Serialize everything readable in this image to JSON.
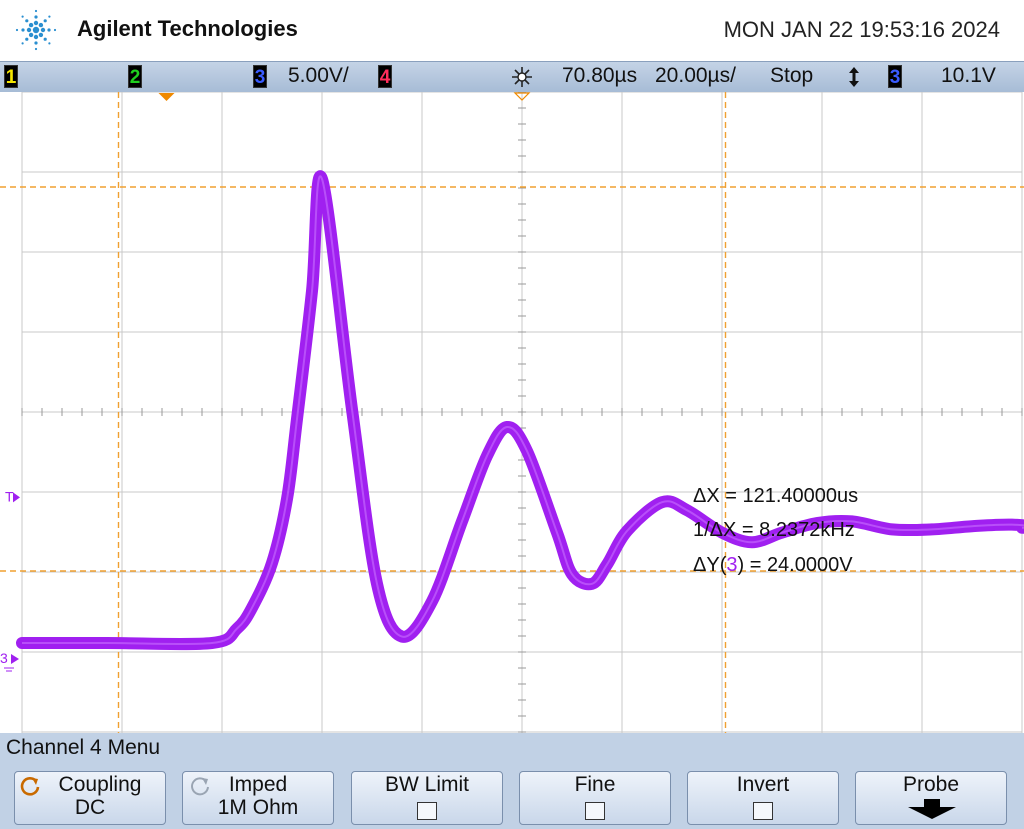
{
  "header": {
    "brand": "Agilent Technologies",
    "datetime": "MON JAN 22 19:53:16 2024"
  },
  "status_bar": {
    "ch1": "1",
    "ch2": "2",
    "ch3": "3",
    "ch3_scale": "5.00V/",
    "ch4": "4",
    "delay": "70.80µs",
    "timebase": "20.00µs/",
    "run_state": "Stop",
    "trigger_slope_icon": "rising-edge-icon",
    "trigger_source": "3",
    "trigger_level": "10.1V"
  },
  "colors": {
    "ch1": "#f5e600",
    "ch2": "#1fcf1f",
    "ch3": "#3a5cff",
    "ch4": "#ff2d5b",
    "trace": "#a020f0",
    "grid": "#c8c8c8",
    "cursor": "#f0a030",
    "menubar": "#c1d1e5"
  },
  "markers": {
    "trigger_level_label": "T",
    "ch3_ground_label": "3"
  },
  "measurements": {
    "delta_x": "ΔX = 121.40000us",
    "inv_delta_x": "1/ΔX = 8.2372kHz",
    "delta_y_prefix": "ΔY(",
    "delta_y_channel": "3",
    "delta_y_suffix": ") = 24.0000V"
  },
  "menu": {
    "title": "Channel 4  Menu",
    "softkeys": [
      {
        "label": "Coupling",
        "value": "DC"
      },
      {
        "label": "Imped",
        "value": "1M Ohm"
      },
      {
        "label": "BW Limit"
      },
      {
        "label": "Fine"
      },
      {
        "label": "Invert"
      },
      {
        "label": "Probe"
      }
    ]
  },
  "chart_data": {
    "type": "line",
    "xlabel": "",
    "ylabel": "",
    "grid": true,
    "x_divisions": 10,
    "y_divisions": 8,
    "x_units": "µs",
    "y_units": "V",
    "series": [
      {
        "x": [
          -83,
          -62,
          -57,
          -54,
          -50,
          -47,
          -45,
          -42,
          -40,
          -34,
          -29,
          -24,
          -18,
          -12,
          -7,
          -3,
          1,
          7,
          10,
          14,
          17,
          21,
          28,
          33,
          40,
          46,
          52,
          59,
          66,
          74,
          82,
          90,
          98,
          106,
          117
        ],
        "y": [
          1.0,
          1.0,
          1.9,
          3.2,
          6.0,
          10.0,
          15.0,
          23.0,
          30.0,
          15.6,
          4.7,
          1.4,
          3.6,
          8.6,
          12.7,
          14.5,
          13.0,
          7.9,
          5.3,
          4.7,
          5.9,
          8.0,
          9.8,
          9.3,
          7.9,
          7.3,
          7.9,
          8.5,
          8.6,
          8.1,
          8.1,
          8.3,
          8.4,
          8.2,
          8.2
        ]
      }
    ],
    "cursors": {
      "x1": -80.7,
      "x2": 40.7,
      "y1": 29.5,
      "y2": 5.5
    }
  }
}
